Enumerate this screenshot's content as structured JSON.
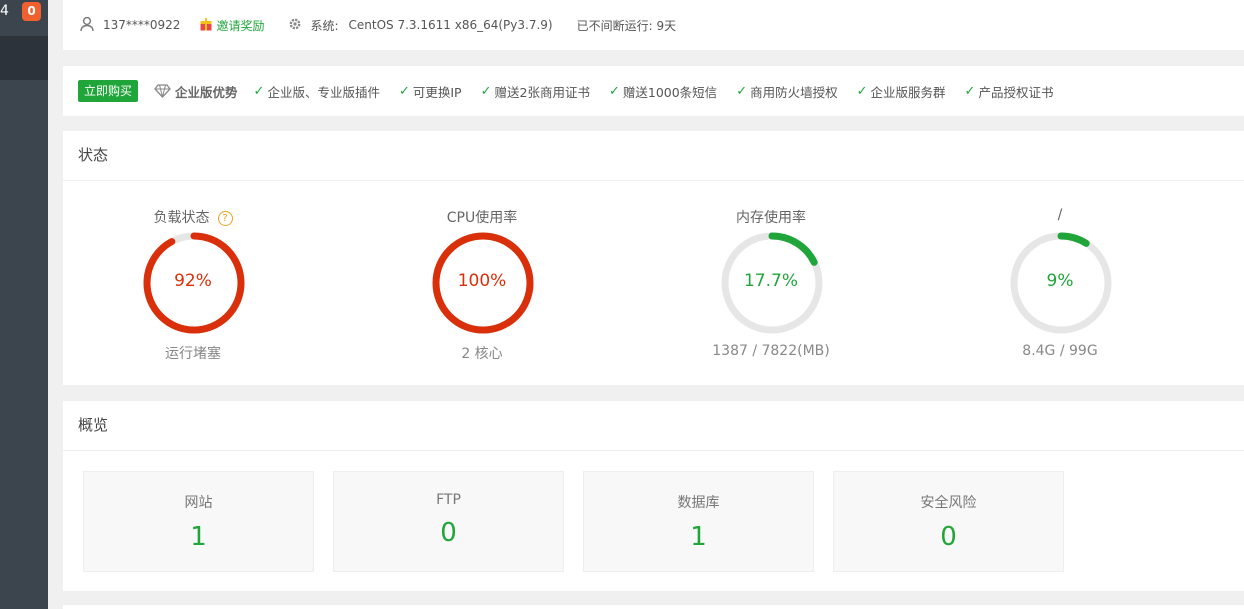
{
  "sidebar": {
    "number": "4",
    "badge": "0"
  },
  "header": {
    "user": "137****0922",
    "invite": "邀请奖励",
    "system_label": "系统:",
    "system_value": "CentOS 7.3.1611 x86_64(Py3.7.9)",
    "uptime": "已不间断运行: 9天"
  },
  "promo": {
    "buy_button": "立即购买",
    "enterprise_label": "企业版优势",
    "features": [
      "企业版、专业版插件",
      "可更换IP",
      "赠送2张商用证书",
      "赠送1000条短信",
      "商用防火墙授权",
      "企业版服务群",
      "产品授权证书"
    ]
  },
  "status": {
    "title": "状态",
    "gauges": [
      {
        "label": "负载状态",
        "value_text": "92%",
        "percent": 92,
        "sub": "运行堵塞",
        "color": "#d92f0a"
      },
      {
        "label": "CPU使用率",
        "value_text": "100%",
        "percent": 100,
        "sub": "2 核心",
        "color": "#d92f0a"
      },
      {
        "label": "内存使用率",
        "value_text": "17.7%",
        "percent": 17.7,
        "sub": "1387 / 7822(MB)",
        "color": "#20a53a"
      },
      {
        "label": "/",
        "value_text": "9%",
        "percent": 9,
        "sub": "8.4G / 99G",
        "color": "#20a53a"
      }
    ]
  },
  "overview": {
    "title": "概览",
    "tiles": [
      {
        "label": "网站",
        "value": "1"
      },
      {
        "label": "FTP",
        "value": "0"
      },
      {
        "label": "数据库",
        "value": "1"
      },
      {
        "label": "安全风险",
        "value": "0"
      }
    ]
  },
  "colors": {
    "accent": "#20a53a",
    "danger": "#d92f0a",
    "sidebar": "#3c444d"
  }
}
